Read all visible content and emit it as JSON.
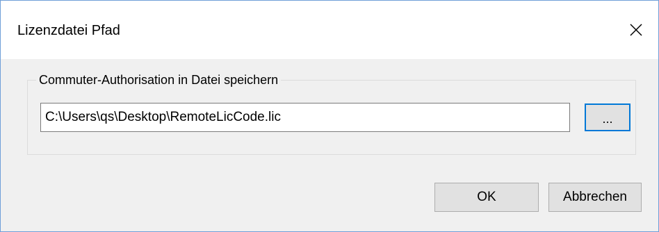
{
  "window": {
    "title": "Lizenzdatei Pfad",
    "close_symbol": "close-icon"
  },
  "group": {
    "label": "Commuter-Authorisation in Datei speichern"
  },
  "path_field": {
    "value": "C:\\Users\\qs\\Desktop\\RemoteLicCode.lic"
  },
  "browse_button": {
    "label": "..."
  },
  "footer": {
    "ok_label": "OK",
    "cancel_label": "Abbrechen"
  },
  "colors": {
    "accent": "#0078d7",
    "button_bg": "#e1e1e1",
    "dialog_bg": "#f0f0f0"
  }
}
